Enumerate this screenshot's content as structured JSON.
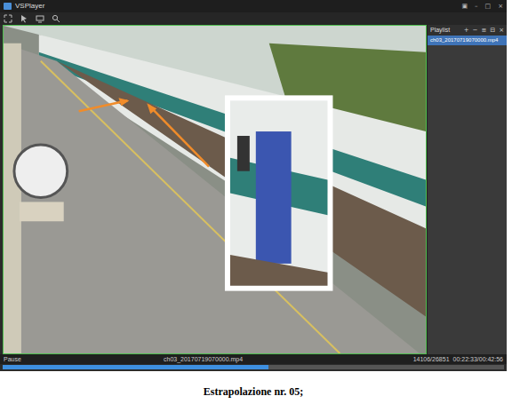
{
  "window": {
    "title": "VSPlayer",
    "controls": [
      "▣",
      "–",
      "□",
      "×"
    ]
  },
  "playlist": {
    "title": "Playlist",
    "tools": [
      "+",
      "−",
      "≡",
      "⊟",
      "×"
    ],
    "items": [
      {
        "label": "ch03_20170719070000.mp4",
        "selected": true
      }
    ]
  },
  "status_bar": {
    "state": "Pause",
    "file": "ch03_20170719070000.mp4",
    "counter": "14106/26851",
    "time": "00:22:33/00:42:56"
  },
  "progress": {
    "level": 0.53
  },
  "caption": "Estrapolazione nr. 05;"
}
